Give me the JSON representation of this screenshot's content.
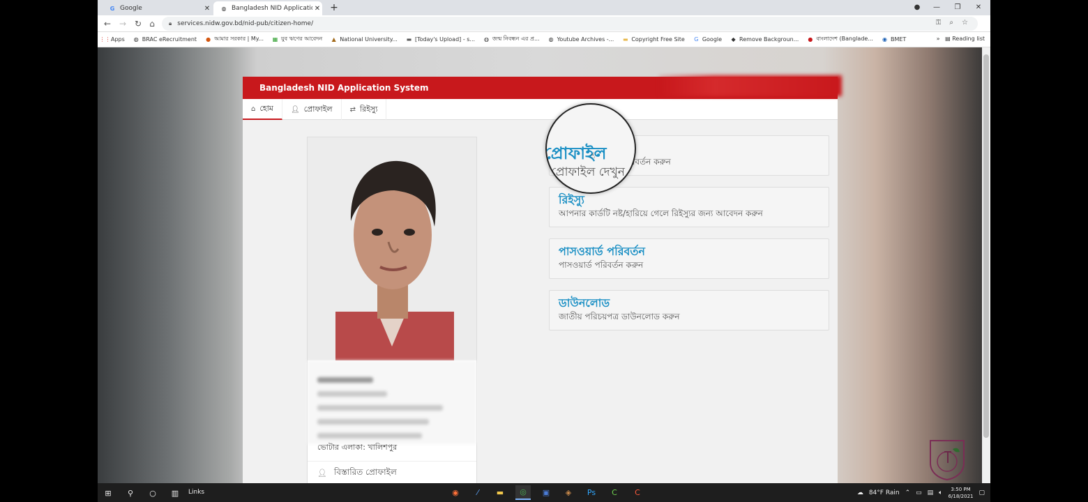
{
  "browser": {
    "tabs": [
      {
        "title": "Google",
        "icon": "google-g"
      },
      {
        "title": "Bangladesh NID Application Syst",
        "icon": "globe"
      }
    ],
    "url": "services.nidw.gov.bd/nid-pub/citizen-home/",
    "bookmarks": [
      "Apps",
      "BRAC eRecruitment",
      "আমার সরকার | My...",
      "যুব ঋণের আবেদন",
      "National University...",
      "[Today's Upload] - s...",
      "জন্ম নিবন্ধন এর প্র...",
      "Youtube Archives -...",
      "Copyright Free Site",
      "Google",
      "Remove Backgroun...",
      "বাংলাদেশ (Banglade...",
      "BMET"
    ],
    "reading_list": "Reading list"
  },
  "app": {
    "title": "Bangladesh NID Application System",
    "nav": [
      {
        "label": "হোম",
        "icon": "home-icon"
      },
      {
        "label": "প্রোফাইল",
        "icon": "user-icon"
      },
      {
        "label": "রিইস্যু",
        "icon": "retweet-icon"
      }
    ],
    "profile": {
      "address_line": "ভোটার এলাকা: খালিশপুর",
      "detail_link": "বিস্তারিত প্রোফাইল"
    },
    "menu": [
      {
        "title": "প্রোফাইল",
        "desc": "প্রোফাইল দেখুন ও পরিবর্তন করুন"
      },
      {
        "title": "রিইস্যু",
        "desc": "আপনার কার্ডটি নষ্ট/হারিয়ে গেলে রিইস্যুর জন্য আবেদন করুন"
      },
      {
        "title": "পাসওয়ার্ড পরিবর্তন",
        "desc": "পাসওয়ার্ড পরিবর্তন করুন"
      },
      {
        "title": "ডাউনলোড",
        "desc": "জাতীয় পরিচয়পত্র ডাউনলোড করুন"
      }
    ],
    "magnifier": {
      "title": "প্রোফাইল",
      "desc": "প্রোফাইল দেখুন"
    }
  },
  "taskbar": {
    "links_label": "Links",
    "weather": "84°F Rain",
    "time": "3:50 PM",
    "date": "6/18/2021"
  },
  "colors": {
    "brand_red": "#c8181c",
    "link_blue": "#1a8fc4"
  }
}
